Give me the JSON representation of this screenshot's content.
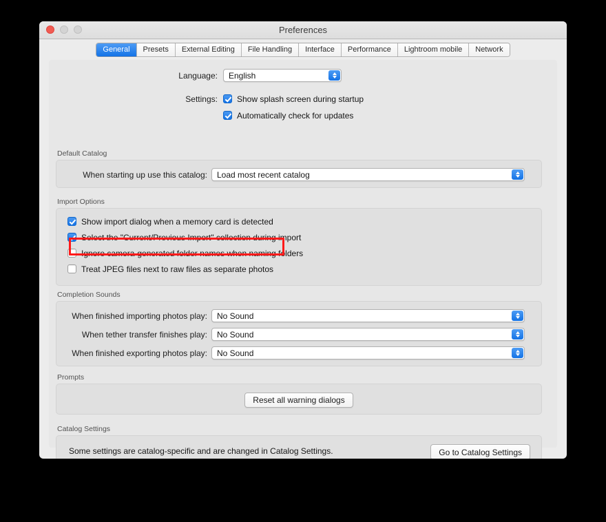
{
  "window": {
    "title": "Preferences",
    "traffic_lights": [
      "close-button",
      "minimize-button",
      "zoom-button"
    ]
  },
  "tabs": [
    {
      "label": "General",
      "active": true
    },
    {
      "label": "Presets",
      "active": false
    },
    {
      "label": "External Editing",
      "active": false
    },
    {
      "label": "File Handling",
      "active": false
    },
    {
      "label": "Interface",
      "active": false
    },
    {
      "label": "Performance",
      "active": false
    },
    {
      "label": "Lightroom mobile",
      "active": false
    },
    {
      "label": "Network",
      "active": false
    }
  ],
  "top": {
    "language_label": "Language:",
    "language_value": "English",
    "settings_label": "Settings:",
    "settings_checks": [
      {
        "label": "Show splash screen during startup",
        "checked": true
      },
      {
        "label": "Automatically check for updates",
        "checked": true
      }
    ]
  },
  "default_catalog": {
    "title": "Default Catalog",
    "row_label": "When starting up use this catalog:",
    "row_value": "Load most recent catalog"
  },
  "import_options": {
    "title": "Import Options",
    "checks": [
      {
        "label": "Show import dialog when a memory card is detected",
        "checked": true
      },
      {
        "label": "Select the \"Current/Previous Import\" collection during import",
        "checked": true
      },
      {
        "label": "Ignore camera-generated folder names when naming folders",
        "checked": false
      },
      {
        "label": "Treat JPEG files next to raw files as separate photos",
        "checked": false
      }
    ]
  },
  "completion_sounds": {
    "title": "Completion Sounds",
    "rows": [
      {
        "label": "When finished importing photos play:",
        "value": "No Sound"
      },
      {
        "label": "When tether transfer finishes play:",
        "value": "No Sound"
      },
      {
        "label": "When finished exporting photos play:",
        "value": "No Sound"
      }
    ]
  },
  "prompts": {
    "title": "Prompts",
    "button": "Reset all warning dialogs"
  },
  "catalog_settings": {
    "title": "Catalog Settings",
    "text": "Some settings are catalog-specific and are changed in Catalog Settings.",
    "button": "Go to Catalog Settings"
  },
  "annotation": {
    "highlight_color": "#ff1a1a",
    "target": "Treat JPEG files next to raw files as separate photos"
  }
}
